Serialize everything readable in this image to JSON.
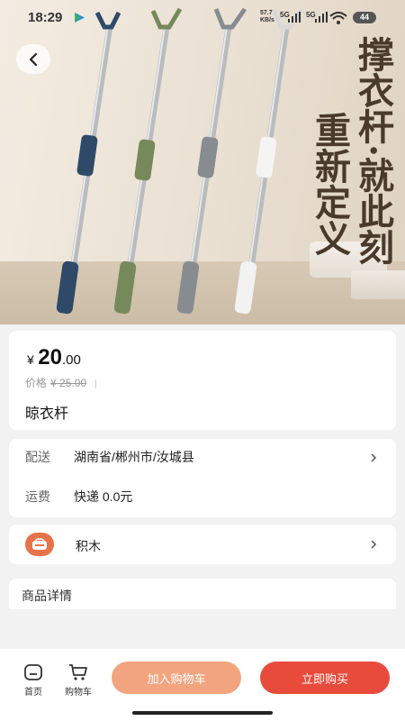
{
  "status_bar": {
    "time": "18:29",
    "net_speed": "57.7",
    "net_unit": "KB/s",
    "sig1": "5G",
    "sig2": "5G",
    "battery": "44"
  },
  "hero": {
    "headline_1": "撑衣杆·就此刻",
    "headline_2": "重新定义",
    "pole_colors": [
      "#2e4a68",
      "#76895a",
      "#878c91",
      "#f2f2f2"
    ]
  },
  "product": {
    "currency": "¥",
    "price_int": "20",
    "price_dec": ".00",
    "orig_label": "价格",
    "orig_price": "¥ 25.00",
    "title": "晾衣杆"
  },
  "shipping": {
    "deliver_label": "配送",
    "deliver_value": "湖南省/郴州市/汝城县",
    "fee_label": "运费",
    "fee_value": "快递 0.0元"
  },
  "shop": {
    "name": "积木"
  },
  "details": {
    "title": "商品详情"
  },
  "bottom": {
    "home_label": "首页",
    "cart_label": "购物车",
    "add_cart": "加入购物车",
    "buy_now": "立即购买"
  }
}
